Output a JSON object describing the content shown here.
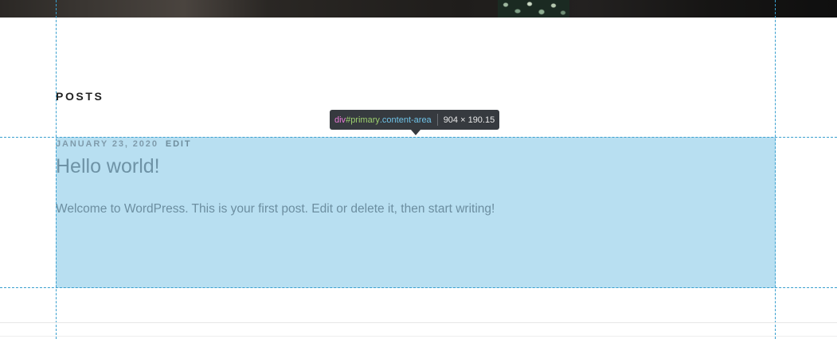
{
  "section": {
    "title": "POSTS"
  },
  "post": {
    "date": "JANUARY 23, 2020",
    "edit_label": "EDIT",
    "title": "Hello world!",
    "excerpt": "Welcome to WordPress. This is your first post. Edit or delete it, then start writing!"
  },
  "inspector": {
    "tag": "div",
    "hash": "#",
    "id": "primary",
    "class": ".content-area",
    "dimensions": "904 × 190.15"
  },
  "colors": {
    "highlight": "#b8dff1",
    "guide": "#3aa0cf",
    "tooltip_bg": "#363a3f"
  }
}
